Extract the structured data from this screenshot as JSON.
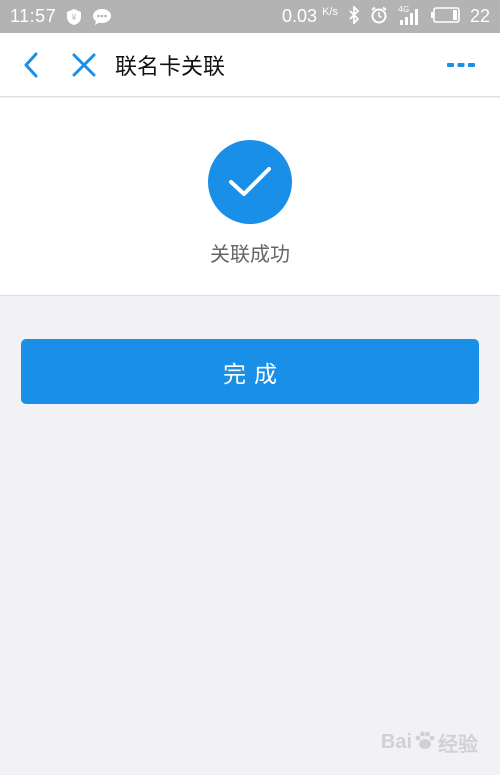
{
  "status_bar": {
    "time": "11:57",
    "net_speed": "0.03",
    "net_unit": "K/s",
    "network_label": "4G",
    "battery": "22",
    "icons": [
      "shield-icon",
      "chat-icon",
      "bluetooth-icon",
      "alarm-icon",
      "signal-icon",
      "battery-icon"
    ]
  },
  "nav": {
    "title": "联名卡关联",
    "back_icon": "chevron-left-icon",
    "close_icon": "close-icon",
    "more_icon": "more-icon"
  },
  "result": {
    "icon": "check-icon",
    "message": "关联成功"
  },
  "actions": {
    "done_label": "完成"
  },
  "watermark": {
    "prefix": "Bai",
    "suffix": "经验"
  },
  "colors": {
    "accent": "#1a8fe8",
    "status_bar_bg": "#b3b3b3",
    "page_bg": "#f2f2f6"
  }
}
